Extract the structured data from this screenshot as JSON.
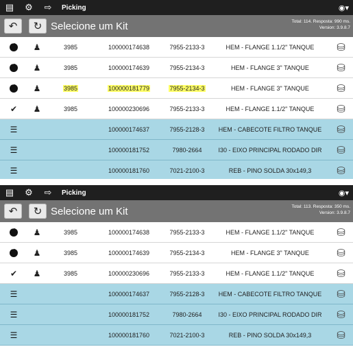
{
  "app": {
    "title": "Picking",
    "page_title": "Selecione um Kit",
    "icons": {
      "menu": "list-icon",
      "settings": "gear-icon",
      "exit": "exit-icon",
      "camera": "camera-icon",
      "undo": "undo-icon",
      "refresh": "refresh-icon"
    }
  },
  "top_panel": {
    "info_line1": "Total: 114. Resposta: 990 ms.",
    "info_line2": "Version: 3.9.8.7",
    "rows": [
      {
        "type": "pending",
        "user": "person",
        "num": "3985",
        "id": "100000174638",
        "code": "7955-2133-3",
        "desc": "HEM - FLANGE 1.1/2\" TANQUE",
        "highlight": false,
        "blue": false
      },
      {
        "type": "pending",
        "user": "person",
        "num": "3985",
        "id": "100000174639",
        "code": "7955-2134-3",
        "desc": "HEM - FLANGE 3\" TANQUE",
        "highlight": false,
        "blue": false
      },
      {
        "type": "pending",
        "user": "person",
        "num": "3985",
        "id": "100000181779",
        "code": "7955-2134-3",
        "desc": "HEM - FLANGE 3\" TANQUE",
        "highlight": true,
        "blue": false
      },
      {
        "type": "done",
        "user": "person",
        "num": "3985",
        "id": "100000230696",
        "code": "7955-2133-3",
        "desc": "HEM - FLANGE 1.1/2\" TANQUE",
        "highlight": false,
        "blue": false
      },
      {
        "type": "list",
        "user": "",
        "num": "",
        "id": "100000174637",
        "code": "7955-2128-3",
        "desc": "HEM - CABECOTE FILTRO TANQUE",
        "highlight": false,
        "blue": true
      },
      {
        "type": "list",
        "user": "",
        "num": "",
        "id": "100000181752",
        "code": "7980-2664",
        "desc": "I30 - EIXO PRINCIPAL RODADO DIR",
        "highlight": false,
        "blue": true
      },
      {
        "type": "list",
        "user": "",
        "num": "",
        "id": "100000181760",
        "code": "7021-2100-3",
        "desc": "REB - PINO SOLDA 30x149,3",
        "highlight": false,
        "blue": true
      }
    ]
  },
  "bottom_panel": {
    "info_line1": "Total: 113. Resposta: 350 ms.",
    "info_line2": "Version: 3.9.8.7",
    "rows": [
      {
        "type": "pending",
        "user": "person",
        "num": "3985",
        "id": "100000174638",
        "code": "7955-2133-3",
        "desc": "HEM - FLANGE 1.1/2\" TANQUE",
        "highlight": false,
        "blue": false
      },
      {
        "type": "pending",
        "user": "person",
        "num": "3985",
        "id": "100000174639",
        "code": "7955-2134-3",
        "desc": "HEM - FLANGE 3\" TANQUE",
        "highlight": false,
        "blue": false
      },
      {
        "type": "done",
        "user": "person",
        "num": "3985",
        "id": "100000230696",
        "code": "7955-2133-3",
        "desc": "HEM - FLANGE 1.1/2\" TANQUE",
        "highlight": false,
        "blue": false
      },
      {
        "type": "list",
        "user": "",
        "num": "",
        "id": "100000174637",
        "code": "7955-2128-3",
        "desc": "HEM - CABECOTE FILTRO TANQUE",
        "highlight": false,
        "blue": true
      },
      {
        "type": "list",
        "user": "",
        "num": "",
        "id": "100000181752",
        "code": "7980-2664",
        "desc": "I30 - EIXO PRINCIPAL RODADO DIR",
        "highlight": false,
        "blue": true
      },
      {
        "type": "list",
        "user": "",
        "num": "",
        "id": "100000181760",
        "code": "7021-2100-3",
        "desc": "REB - PINO SOLDA 30x149,3",
        "highlight": false,
        "blue": true
      }
    ]
  },
  "colors": {
    "row_blue": "#a9d7e5",
    "highlight": "#ffff66",
    "topbar": "#1f1f1f",
    "titlebar": "#737373"
  }
}
